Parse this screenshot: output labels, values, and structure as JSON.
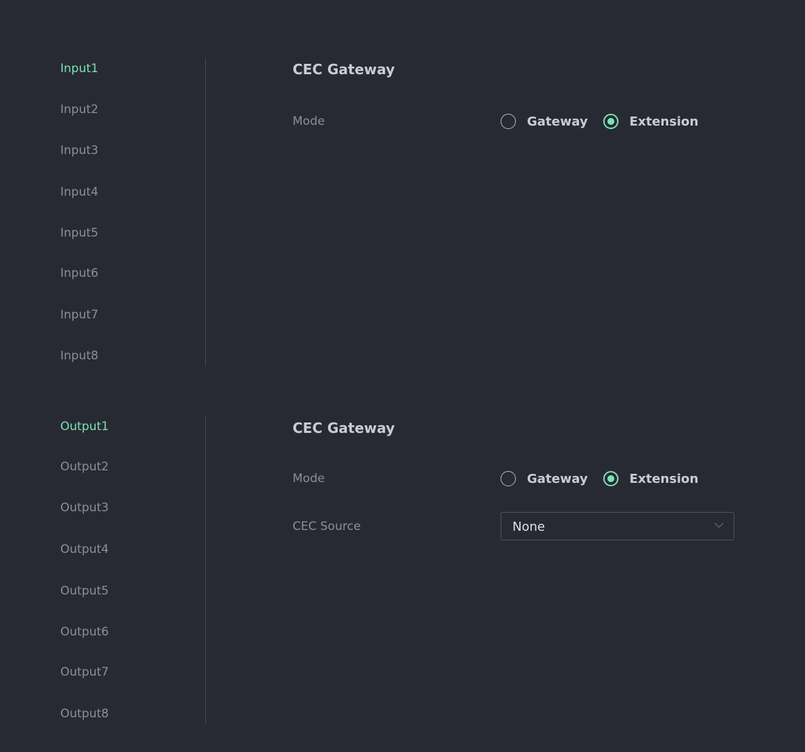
{
  "inputs": {
    "nav": [
      "Input1",
      "Input2",
      "Input3",
      "Input4",
      "Input5",
      "Input6",
      "Input7",
      "Input8"
    ],
    "active_index": 0,
    "heading": "CEC Gateway",
    "mode_label": "Mode",
    "mode_options": [
      "Gateway",
      "Extension"
    ],
    "mode_selected": "Extension"
  },
  "outputs": {
    "nav": [
      "Output1",
      "Output2",
      "Output3",
      "Output4",
      "Output5",
      "Output6",
      "Output7",
      "Output8"
    ],
    "active_index": 0,
    "heading": "CEC Gateway",
    "mode_label": "Mode",
    "mode_options": [
      "Gateway",
      "Extension"
    ],
    "mode_selected": "Extension",
    "cec_source_label": "CEC Source",
    "cec_source_value": "None"
  },
  "colors": {
    "background": "#282a33",
    "accent": "#7be3b6",
    "muted_text": "#8b8f99",
    "heading_text": "#c9ccd3"
  }
}
